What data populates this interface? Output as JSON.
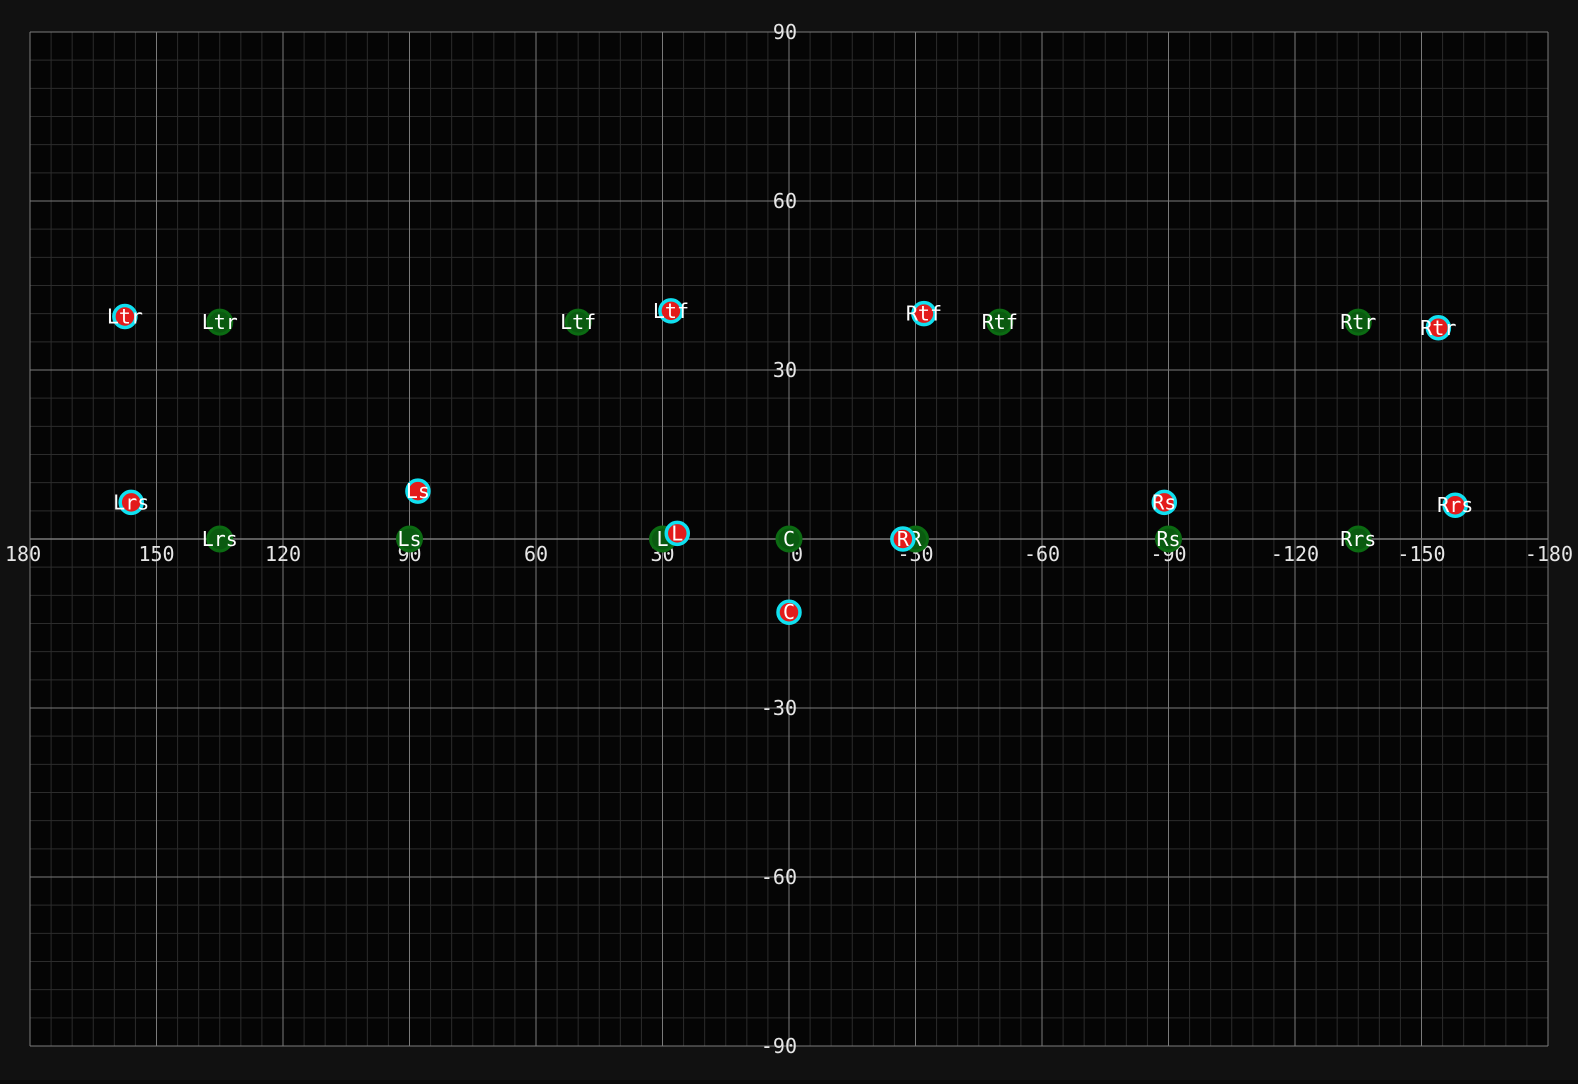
{
  "colors": {
    "background": "#050505",
    "frame": "#111111",
    "grid_minor": "#2c2c2c",
    "grid_major": "#7a7a7a",
    "tick_label": "#e6e6e6",
    "label_text": "#ffffff",
    "reference_ring": "#0b6b12",
    "reference_fill": "#0a5a10",
    "measured_ring": "#10e0f0",
    "measured_fill": "#e31b1b"
  },
  "chart_data": {
    "type": "scatter",
    "title": "",
    "xlabel": "",
    "ylabel": "",
    "xlim": [
      180,
      -180
    ],
    "ylim": [
      -90,
      90
    ],
    "x_ticks": [
      "180",
      "150",
      "120",
      "90",
      "60",
      "30",
      "0",
      "-30",
      "-60",
      "-90",
      "-120",
      "-150",
      "-180"
    ],
    "y_ticks": [
      "90",
      "60",
      "30",
      "-30",
      "-60",
      "-90"
    ],
    "grid": true,
    "legend": "none",
    "series": [
      {
        "role": "reference",
        "points": [
          {
            "label": "Ltr",
            "x": 135,
            "y": 38.5
          },
          {
            "label": "Lrs",
            "x": 135,
            "y": 0
          },
          {
            "label": "Ltf",
            "x": 50,
            "y": 38.5
          },
          {
            "label": "Ls",
            "x": 90,
            "y": 0
          },
          {
            "label": "L",
            "x": 30,
            "y": 0
          },
          {
            "label": "C",
            "x": 0,
            "y": 0
          },
          {
            "label": "R",
            "x": -30,
            "y": 0
          },
          {
            "label": "Rtf",
            "x": -50,
            "y": 38.5
          },
          {
            "label": "Rs",
            "x": -90,
            "y": 0
          },
          {
            "label": "Rtr",
            "x": -135,
            "y": 38.5
          },
          {
            "label": "Rrs",
            "x": -135,
            "y": 0
          }
        ]
      },
      {
        "role": "measured",
        "points": [
          {
            "label": "Ltr",
            "x": 157.5,
            "y": 39.5
          },
          {
            "label": "Lrs",
            "x": 156,
            "y": 6.5
          },
          {
            "label": "Ls",
            "x": 88,
            "y": 8.5
          },
          {
            "label": "Ltf",
            "x": 28,
            "y": 40.5
          },
          {
            "label": "L",
            "x": 26.5,
            "y": 1
          },
          {
            "label": "C",
            "x": 0,
            "y": -13
          },
          {
            "label": "R",
            "x": -27,
            "y": 0
          },
          {
            "label": "Rtf",
            "x": -32,
            "y": 40
          },
          {
            "label": "Rs",
            "x": -89,
            "y": 6.5
          },
          {
            "label": "Rtr",
            "x": -154,
            "y": 37.5
          },
          {
            "label": "Rrs",
            "x": -158,
            "y": 6
          }
        ]
      }
    ]
  }
}
